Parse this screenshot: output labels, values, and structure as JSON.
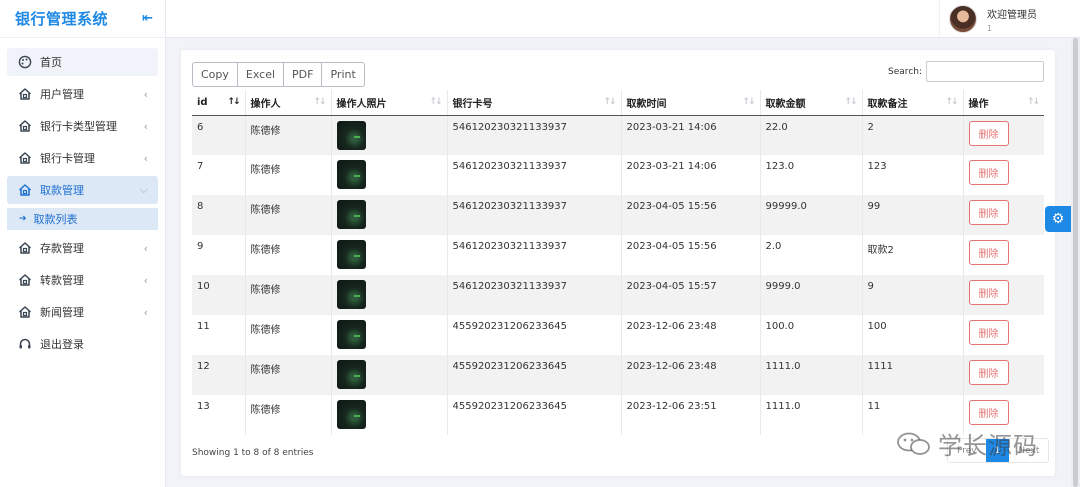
{
  "sidebar": {
    "brand": "银行管理系统",
    "items": [
      {
        "label": "首页",
        "icon": "palette-icon",
        "chevron": false
      },
      {
        "label": "用户管理",
        "icon": "home-icon",
        "chevron": true
      },
      {
        "label": "银行卡类型管理",
        "icon": "home-icon",
        "chevron": true
      },
      {
        "label": "银行卡管理",
        "icon": "home-icon",
        "chevron": true
      },
      {
        "label": "取款管理",
        "icon": "home-icon",
        "chevron": true,
        "expanded": true
      },
      {
        "label": "存款管理",
        "icon": "home-icon",
        "chevron": true
      },
      {
        "label": "转款管理",
        "icon": "home-icon",
        "chevron": true
      },
      {
        "label": "新闻管理",
        "icon": "home-icon",
        "chevron": true
      },
      {
        "label": "退出登录",
        "icon": "headset-icon",
        "chevron": false
      }
    ],
    "sub_item": "取款列表"
  },
  "header": {
    "user_name": "欢迎管理员",
    "user_sub": "1"
  },
  "toolbar": {
    "buttons": [
      "Copy",
      "Excel",
      "PDF",
      "Print"
    ],
    "search_label": "Search:"
  },
  "table": {
    "columns": [
      "id",
      "操作人",
      "操作人照片",
      "银行卡号",
      "取款时间",
      "取款金额",
      "取款备注",
      "操作"
    ],
    "delete_label": "删除",
    "rows": [
      {
        "id": "6",
        "operator": "陈德修",
        "card": "546120230321133937",
        "time": "2023-03-21 14:06",
        "amount": "22.0",
        "note": "2"
      },
      {
        "id": "7",
        "operator": "陈德修",
        "card": "546120230321133937",
        "time": "2023-03-21 14:06",
        "amount": "123.0",
        "note": "123"
      },
      {
        "id": "8",
        "operator": "陈德修",
        "card": "546120230321133937",
        "time": "2023-04-05 15:56",
        "amount": "99999.0",
        "note": "99"
      },
      {
        "id": "9",
        "operator": "陈德修",
        "card": "546120230321133937",
        "time": "2023-04-05 15:56",
        "amount": "2.0",
        "note": "取款2"
      },
      {
        "id": "10",
        "operator": "陈德修",
        "card": "546120230321133937",
        "time": "2023-04-05 15:57",
        "amount": "9999.0",
        "note": "9"
      },
      {
        "id": "11",
        "operator": "陈德修",
        "card": "455920231206233645",
        "time": "2023-12-06 23:48",
        "amount": "100.0",
        "note": "100"
      },
      {
        "id": "12",
        "operator": "陈德修",
        "card": "455920231206233645",
        "time": "2023-12-06 23:48",
        "amount": "1111.0",
        "note": "1111"
      },
      {
        "id": "13",
        "operator": "陈德修",
        "card": "455920231206233645",
        "time": "2023-12-06 23:51",
        "amount": "1111.0",
        "note": "11"
      }
    ]
  },
  "footer": {
    "info": "Showing 1 to 8 of 8 entries",
    "prev": "Prev",
    "page": "1",
    "next": "Next"
  },
  "watermark": "学长源码",
  "colors": {
    "accent": "#1e88e5",
    "danger": "#e57373"
  }
}
